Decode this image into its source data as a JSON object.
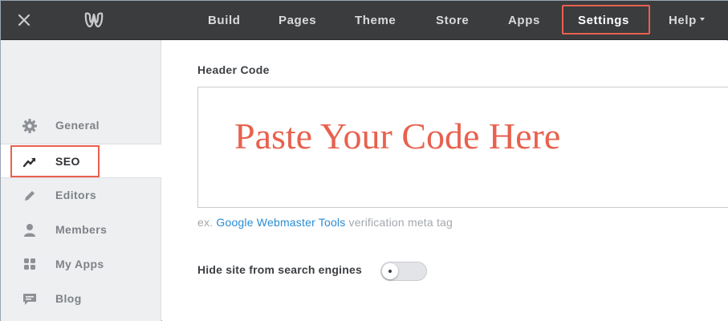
{
  "topbar": {
    "close_icon": "close-icon",
    "logo_icon": "weebly-logo-icon",
    "nav": [
      {
        "label": "Build"
      },
      {
        "label": "Pages"
      },
      {
        "label": "Theme"
      },
      {
        "label": "Store"
      },
      {
        "label": "Apps"
      },
      {
        "label": "Settings",
        "active": true
      },
      {
        "label": "Help",
        "has_dropdown": true
      }
    ]
  },
  "sidebar": {
    "items": [
      {
        "label": "General",
        "icon": "gear-icon"
      },
      {
        "label": "SEO",
        "icon": "trend-up-icon",
        "active": true
      },
      {
        "label": "Editors",
        "icon": "pencil-icon"
      },
      {
        "label": "Members",
        "icon": "person-icon"
      },
      {
        "label": "My Apps",
        "icon": "apps-grid-icon"
      },
      {
        "label": "Blog",
        "icon": "speech-bubble-icon"
      }
    ]
  },
  "main": {
    "header_code_label": "Header Code",
    "code_overlay_text": "Paste Your Code Here",
    "hint_prefix": "ex.",
    "hint_link": "Google Webmaster Tools",
    "hint_suffix": "verification meta tag",
    "hide_label": "Hide site from search engines",
    "hide_toggle_on": false
  },
  "colors": {
    "topbar_bg": "#3a3c3e",
    "sidebar_bg": "#eeeff1",
    "highlight": "#e8614e",
    "link": "#2a8cd3"
  }
}
